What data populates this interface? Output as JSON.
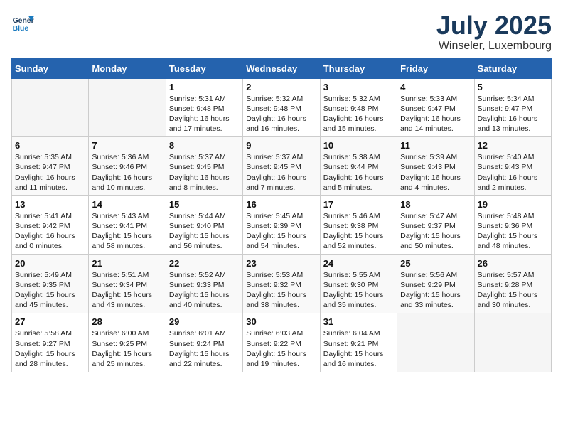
{
  "logo": {
    "line1": "General",
    "line2": "Blue"
  },
  "title": "July 2025",
  "location": "Winseler, Luxembourg",
  "days_header": [
    "Sunday",
    "Monday",
    "Tuesday",
    "Wednesday",
    "Thursday",
    "Friday",
    "Saturday"
  ],
  "weeks": [
    [
      {
        "num": "",
        "info": ""
      },
      {
        "num": "",
        "info": ""
      },
      {
        "num": "1",
        "info": "Sunrise: 5:31 AM\nSunset: 9:48 PM\nDaylight: 16 hours and 17 minutes."
      },
      {
        "num": "2",
        "info": "Sunrise: 5:32 AM\nSunset: 9:48 PM\nDaylight: 16 hours and 16 minutes."
      },
      {
        "num": "3",
        "info": "Sunrise: 5:32 AM\nSunset: 9:48 PM\nDaylight: 16 hours and 15 minutes."
      },
      {
        "num": "4",
        "info": "Sunrise: 5:33 AM\nSunset: 9:47 PM\nDaylight: 16 hours and 14 minutes."
      },
      {
        "num": "5",
        "info": "Sunrise: 5:34 AM\nSunset: 9:47 PM\nDaylight: 16 hours and 13 minutes."
      }
    ],
    [
      {
        "num": "6",
        "info": "Sunrise: 5:35 AM\nSunset: 9:47 PM\nDaylight: 16 hours and 11 minutes."
      },
      {
        "num": "7",
        "info": "Sunrise: 5:36 AM\nSunset: 9:46 PM\nDaylight: 16 hours and 10 minutes."
      },
      {
        "num": "8",
        "info": "Sunrise: 5:37 AM\nSunset: 9:45 PM\nDaylight: 16 hours and 8 minutes."
      },
      {
        "num": "9",
        "info": "Sunrise: 5:37 AM\nSunset: 9:45 PM\nDaylight: 16 hours and 7 minutes."
      },
      {
        "num": "10",
        "info": "Sunrise: 5:38 AM\nSunset: 9:44 PM\nDaylight: 16 hours and 5 minutes."
      },
      {
        "num": "11",
        "info": "Sunrise: 5:39 AM\nSunset: 9:43 PM\nDaylight: 16 hours and 4 minutes."
      },
      {
        "num": "12",
        "info": "Sunrise: 5:40 AM\nSunset: 9:43 PM\nDaylight: 16 hours and 2 minutes."
      }
    ],
    [
      {
        "num": "13",
        "info": "Sunrise: 5:41 AM\nSunset: 9:42 PM\nDaylight: 16 hours and 0 minutes."
      },
      {
        "num": "14",
        "info": "Sunrise: 5:43 AM\nSunset: 9:41 PM\nDaylight: 15 hours and 58 minutes."
      },
      {
        "num": "15",
        "info": "Sunrise: 5:44 AM\nSunset: 9:40 PM\nDaylight: 15 hours and 56 minutes."
      },
      {
        "num": "16",
        "info": "Sunrise: 5:45 AM\nSunset: 9:39 PM\nDaylight: 15 hours and 54 minutes."
      },
      {
        "num": "17",
        "info": "Sunrise: 5:46 AM\nSunset: 9:38 PM\nDaylight: 15 hours and 52 minutes."
      },
      {
        "num": "18",
        "info": "Sunrise: 5:47 AM\nSunset: 9:37 PM\nDaylight: 15 hours and 50 minutes."
      },
      {
        "num": "19",
        "info": "Sunrise: 5:48 AM\nSunset: 9:36 PM\nDaylight: 15 hours and 48 minutes."
      }
    ],
    [
      {
        "num": "20",
        "info": "Sunrise: 5:49 AM\nSunset: 9:35 PM\nDaylight: 15 hours and 45 minutes."
      },
      {
        "num": "21",
        "info": "Sunrise: 5:51 AM\nSunset: 9:34 PM\nDaylight: 15 hours and 43 minutes."
      },
      {
        "num": "22",
        "info": "Sunrise: 5:52 AM\nSunset: 9:33 PM\nDaylight: 15 hours and 40 minutes."
      },
      {
        "num": "23",
        "info": "Sunrise: 5:53 AM\nSunset: 9:32 PM\nDaylight: 15 hours and 38 minutes."
      },
      {
        "num": "24",
        "info": "Sunrise: 5:55 AM\nSunset: 9:30 PM\nDaylight: 15 hours and 35 minutes."
      },
      {
        "num": "25",
        "info": "Sunrise: 5:56 AM\nSunset: 9:29 PM\nDaylight: 15 hours and 33 minutes."
      },
      {
        "num": "26",
        "info": "Sunrise: 5:57 AM\nSunset: 9:28 PM\nDaylight: 15 hours and 30 minutes."
      }
    ],
    [
      {
        "num": "27",
        "info": "Sunrise: 5:58 AM\nSunset: 9:27 PM\nDaylight: 15 hours and 28 minutes."
      },
      {
        "num": "28",
        "info": "Sunrise: 6:00 AM\nSunset: 9:25 PM\nDaylight: 15 hours and 25 minutes."
      },
      {
        "num": "29",
        "info": "Sunrise: 6:01 AM\nSunset: 9:24 PM\nDaylight: 15 hours and 22 minutes."
      },
      {
        "num": "30",
        "info": "Sunrise: 6:03 AM\nSunset: 9:22 PM\nDaylight: 15 hours and 19 minutes."
      },
      {
        "num": "31",
        "info": "Sunrise: 6:04 AM\nSunset: 9:21 PM\nDaylight: 15 hours and 16 minutes."
      },
      {
        "num": "",
        "info": ""
      },
      {
        "num": "",
        "info": ""
      }
    ]
  ]
}
